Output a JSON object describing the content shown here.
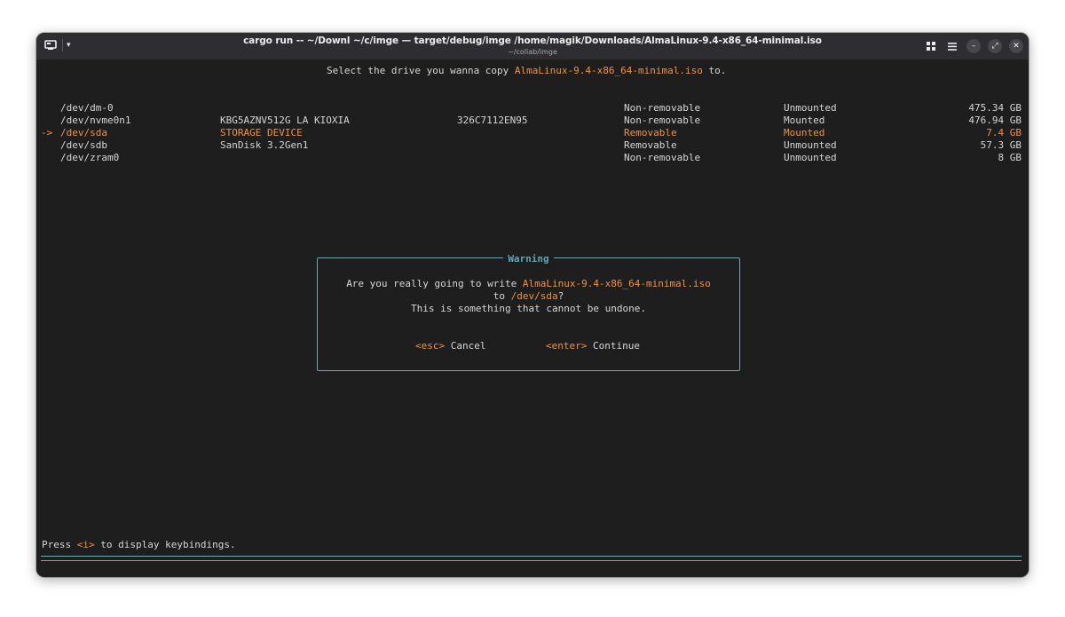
{
  "window": {
    "title": "cargo run -- ~/Downl ~/c/imge — target/debug/imge /home/magik/Downloads/AlmaLinux-9.4-x86_64-minimal.iso",
    "subtitle": "~/collab/imge",
    "accent": "#f0923e",
    "border_color": "#6fa8b4"
  },
  "titlebar": {
    "dropdown_glyph": "▾",
    "grid_glyph": "▦",
    "menu_glyph": "≡",
    "minimize_glyph": "–",
    "maximize_glyph": "⤢",
    "close_glyph": "✕"
  },
  "prompt": {
    "prefix": "Select the drive you wanna copy ",
    "filename": "AlmaLinux-9.4-x86_64-minimal.iso",
    "suffix": " to."
  },
  "drives": [
    {
      "marker": "",
      "path": "/dev/dm-0",
      "model": "",
      "serial": "",
      "removable": "Non-removable",
      "mount": "Unmounted",
      "size": "475.34 GB",
      "selected": false
    },
    {
      "marker": "",
      "path": "/dev/nvme0n1",
      "model": "KBG5AZNV512G LA KIOXIA",
      "serial": "326C7112EN95",
      "removable": "Non-removable",
      "mount": "Mounted",
      "size": "476.94 GB",
      "selected": false
    },
    {
      "marker": "->",
      "path": "/dev/sda",
      "model": "STORAGE DEVICE",
      "serial": "",
      "removable": "Removable",
      "mount": "Mounted",
      "size": "7.4 GB",
      "selected": true
    },
    {
      "marker": "",
      "path": "/dev/sdb",
      "model": "SanDisk 3.2Gen1",
      "serial": "",
      "removable": "Removable",
      "mount": "Unmounted",
      "size": "57.3 GB",
      "selected": false
    },
    {
      "marker": "",
      "path": "/dev/zram0",
      "model": "",
      "serial": "",
      "removable": "Non-removable",
      "mount": "Unmounted",
      "size": "8 GB",
      "selected": false
    }
  ],
  "dialog": {
    "title": "Warning",
    "line1_prefix": "Are you really going to write ",
    "line1_file": "AlmaLinux-9.4-x86_64-minimal.iso",
    "line2_prefix": "to ",
    "line2_target": "/dev/sda",
    "line2_suffix": "?",
    "line3": "This is something that cannot be undone.",
    "cancel_key": "<esc>",
    "cancel_label": " Cancel",
    "continue_key": "<enter>",
    "continue_label": " Continue"
  },
  "footer": {
    "prefix": "Press ",
    "key": "<i>",
    "suffix": " to display keybindings."
  }
}
